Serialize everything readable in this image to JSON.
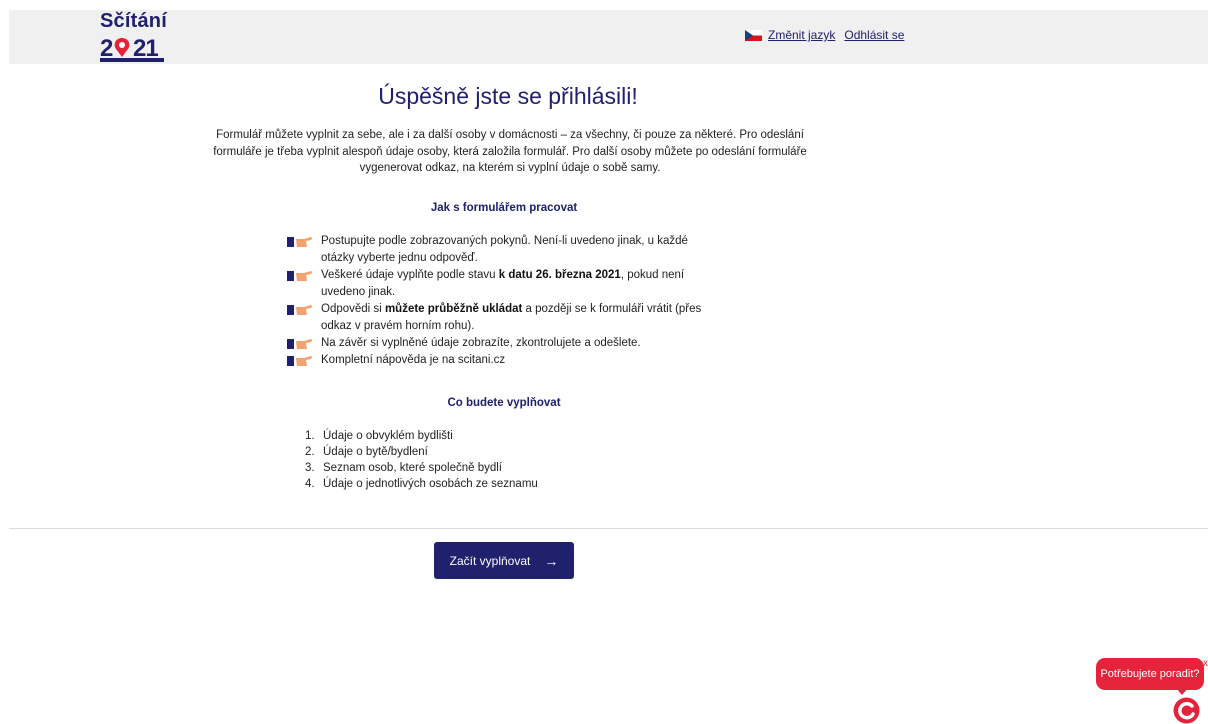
{
  "header": {
    "logo_text": "Sčítání",
    "logo_year": "2021",
    "change_language": "Změnit jazyk",
    "logout": "Odhlásit se"
  },
  "main": {
    "title": "Úspěšně jste se přihlásili!",
    "intro": "Formulář můžete vyplnit za sebe, ale i za další osoby v domácnosti – za všechny, či pouze za některé. Pro odeslání formuláře je třeba vyplnit alespoň údaje osoby, která založila formulář. Pro další osoby můžete po odeslání formuláře vygenerovat odkaz, na kterém si vyplní údaje o sobě samy.",
    "how_heading": "Jak s formulářem pracovat",
    "tips": [
      {
        "before": "Postupujte podle zobrazovaných pokynů. Není-li uvedeno jinak, u každé otázky vyberte jednu odpověď.",
        "bold": "",
        "after": ""
      },
      {
        "before": "Veškeré údaje vyplňte podle stavu ",
        "bold": "k datu 26. března 2021",
        "after": ", pokud není uvedeno jinak."
      },
      {
        "before": "Odpovědi si ",
        "bold": "můžete průběžně ukládat",
        "after": " a později se k formuláři vrátit (přes odkaz v pravém horním rohu)."
      },
      {
        "before": "Na závěr si vyplněné údaje zobrazíte, zkontrolujete a odešlete.",
        "bold": "",
        "after": ""
      },
      {
        "before": "Kompletní nápověda je na scitani.cz",
        "bold": "",
        "after": ""
      }
    ],
    "fill_heading": "Co budete vyplňovat",
    "steps": [
      {
        "num": "1.",
        "text": "Údaje o obvyklém bydlišti"
      },
      {
        "num": "2.",
        "text": "Údaje o bytě/bydlení"
      },
      {
        "num": "3.",
        "text": "Seznam osob, které společně bydlí"
      },
      {
        "num": "4.",
        "text": "Údaje o jednotlivých osobách ze seznamu"
      }
    ],
    "start_button": "Začít vyplňovat",
    "start_arrow": "→"
  },
  "help": {
    "bubble": "Potřebujete poradit?",
    "close": "x"
  },
  "colors": {
    "brand_navy": "#20206d",
    "accent_red": "#e5243b",
    "hand_orange": "#f4a26f"
  }
}
